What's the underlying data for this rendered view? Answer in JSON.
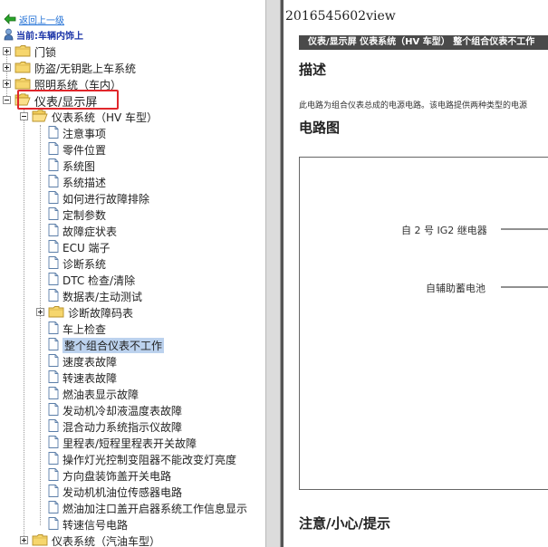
{
  "nav": {
    "back_label": "返回上一级",
    "current_label": "当前:车辆内饰上"
  },
  "tree": [
    {
      "label": "门锁",
      "type": "folder",
      "state": "collapsed"
    },
    {
      "label": "防盗/无钥匙上车系统",
      "type": "folder",
      "state": "collapsed"
    },
    {
      "label": "照明系统（车内）",
      "type": "folder",
      "state": "collapsed"
    },
    {
      "label": "仪表/显示屏",
      "type": "folder",
      "state": "expanded",
      "highlighted": true
    },
    {
      "label": "仪表系统（HV 车型）",
      "type": "folder",
      "state": "expanded"
    },
    {
      "label": "注意事项",
      "type": "doc"
    },
    {
      "label": "零件位置",
      "type": "doc"
    },
    {
      "label": "系统图",
      "type": "doc"
    },
    {
      "label": "系统描述",
      "type": "doc"
    },
    {
      "label": "如何进行故障排除",
      "type": "doc"
    },
    {
      "label": "定制参数",
      "type": "doc"
    },
    {
      "label": "故障症状表",
      "type": "doc"
    },
    {
      "label": "ECU 端子",
      "type": "doc"
    },
    {
      "label": "诊断系统",
      "type": "doc"
    },
    {
      "label": "DTC 检查/清除",
      "type": "doc"
    },
    {
      "label": "数据表/主动测试",
      "type": "doc"
    },
    {
      "label": "诊断故障码表",
      "type": "folder",
      "state": "collapsed"
    },
    {
      "label": "车上检查",
      "type": "doc"
    },
    {
      "label": "整个组合仪表不工作",
      "type": "doc",
      "selected": true
    },
    {
      "label": "速度表故障",
      "type": "doc"
    },
    {
      "label": "转速表故障",
      "type": "doc"
    },
    {
      "label": "燃油表显示故障",
      "type": "doc"
    },
    {
      "label": "发动机冷却液温度表故障",
      "type": "doc"
    },
    {
      "label": "混合动力系统指示仪故障",
      "type": "doc"
    },
    {
      "label": "里程表/短程里程表开关故障",
      "type": "doc"
    },
    {
      "label": "操作灯光控制变阻器不能改变灯亮度",
      "type": "doc"
    },
    {
      "label": "方向盘装饰盖开关电路",
      "type": "doc"
    },
    {
      "label": "发动机机油位传感器电路",
      "type": "doc"
    },
    {
      "label": "燃油加注口盖开启器系统工作信息显示",
      "type": "doc"
    },
    {
      "label": "转速信号电路",
      "type": "doc"
    },
    {
      "label": "仪表系统（汽油车型）",
      "type": "folder",
      "state": "collapsed"
    }
  ],
  "content": {
    "doc_id": "2016545602view",
    "title_bar": "仪表/显示屏  仪表系统（HV 车型）  整个组合仪表不工作",
    "section_description": "描述",
    "description_text": "此电路为组合仪表总成的电源电路。该电路提供两种类型的电源",
    "section_circuit": "电路图",
    "circuit_sources": [
      "自 2 号 IG2 继电器",
      "自辅助蓄电池"
    ],
    "section_notice": "注意/小心/提示"
  },
  "colors": {
    "link": "#1f6fd6",
    "current": "#1c35a8",
    "highlight_box": "#e0262b",
    "selected_bg": "#bcd2ee",
    "title_bar_bg": "#4a4a4a"
  }
}
